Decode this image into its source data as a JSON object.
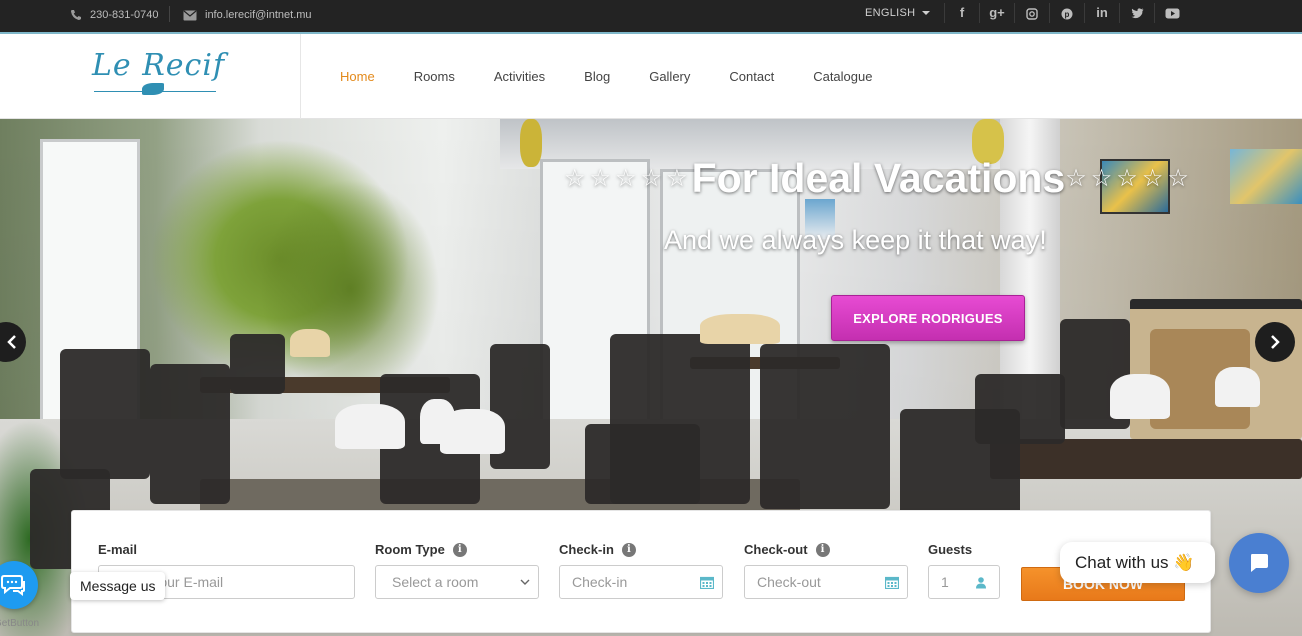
{
  "topbar": {
    "phone": "230-831-0740",
    "email": "info.lerecif@intnet.mu",
    "language": "ENGLISH",
    "socials": [
      "facebook-icon",
      "google-plus-icon",
      "instagram-icon",
      "pinterest-icon",
      "linkedin-icon",
      "twitter-icon",
      "youtube-icon"
    ]
  },
  "header": {
    "logo": "Le Recif",
    "nav": [
      "Home",
      "Rooms",
      "Activities",
      "Blog",
      "Gallery",
      "Contact",
      "Catalogue"
    ],
    "active_nav": "Home",
    "accent": "#e38a1c"
  },
  "hero": {
    "title_stars_left": "☆☆☆☆☆",
    "title": "For Ideal Vacations",
    "title_stars_right": "☆☆☆☆☆",
    "subtitle": "And we always keep it that way!",
    "cta": "EXPLORE RODRIGUES",
    "cta_color": "#d93cc4"
  },
  "booking": {
    "email_label": "E-mail",
    "email_placeholder": "Enter your E-mail",
    "room_label": "Room Type",
    "room_value": "Select a room",
    "checkin_label": "Check-in",
    "checkin_placeholder": "Check-in",
    "checkout_label": "Check-out",
    "checkout_placeholder": "Check-out",
    "guests_label": "Guests",
    "guests_value": "1",
    "submit": "BOOK NOW",
    "submit_color": "#ef8624"
  },
  "widgets": {
    "message_label": "Message us",
    "getbutton": "GetButton",
    "chat_label": "Chat with us 👋"
  }
}
